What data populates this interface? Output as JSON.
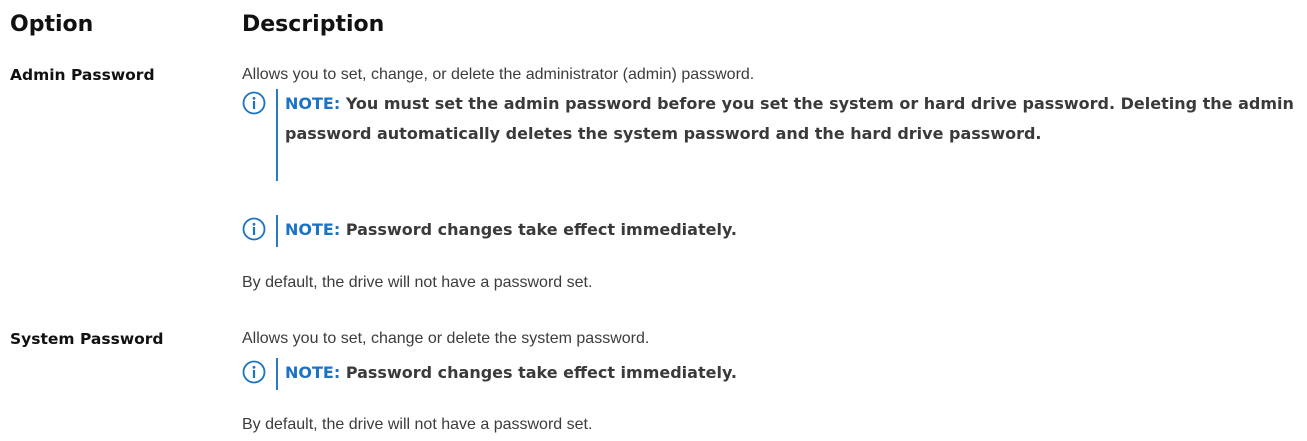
{
  "header": {
    "option": "Option",
    "description": "Description"
  },
  "rows": [
    {
      "label": "Admin Password",
      "intro": "Allows you to set, change, or delete the administrator (admin) password.",
      "notes": [
        {
          "label": "NOTE:",
          "text": "You must set the admin password before you set the system or hard drive password. Deleting the admin password automatically deletes the system password and the hard drive password."
        },
        {
          "label": "NOTE:",
          "text": "Password changes take effect immediately."
        }
      ],
      "footer": "By default, the drive will not have a password set."
    },
    {
      "label": "System Password",
      "intro": "Allows you to set, change or delete the system password.",
      "notes": [
        {
          "label": "NOTE:",
          "text": "Password changes take effect immediately."
        }
      ],
      "footer": "By default, the drive will not have a password set."
    }
  ],
  "colors": {
    "note_accent": "#1a73c4",
    "heading": "#111111",
    "body": "#3c3c3c"
  },
  "icons": {
    "note": "info-icon"
  }
}
